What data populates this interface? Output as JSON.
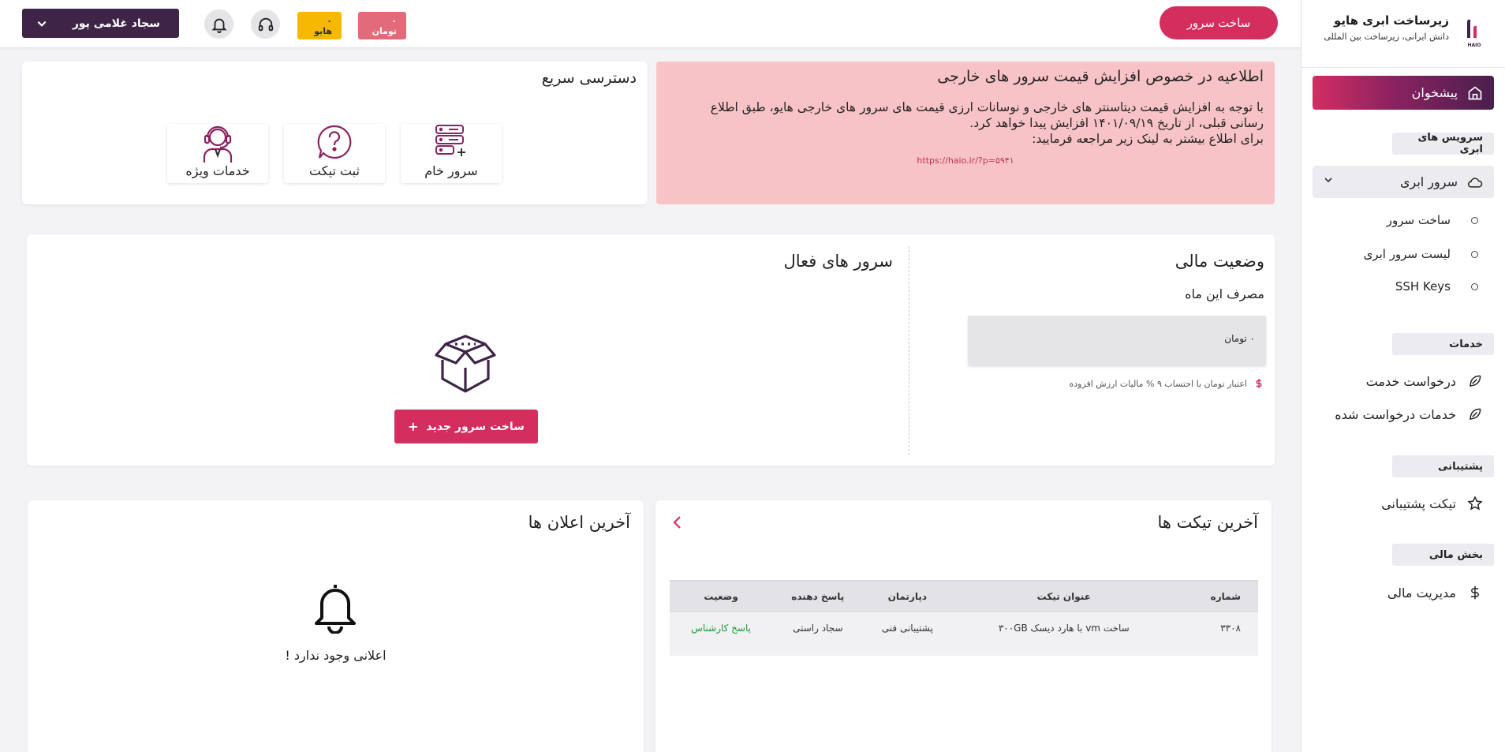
{
  "brand": {
    "title": "زیرساخت ابری هایو",
    "subtitle": "دانش ایرانی، زیرساخت بین المللی",
    "logo_text": "HAIO",
    "accent": "#d42e5f",
    "dark": "#3e2447"
  },
  "sidebar": {
    "dashboard_label": "پیشخوان",
    "sections": {
      "cloud_services": "سرویس های ابری",
      "services": "خدمات",
      "support": "پشتیبانی",
      "finance": "بخش مالی"
    },
    "cloud_server": "سرور ابری",
    "cloud_sub": [
      "ساخت سرور",
      "لیست سرور ابری",
      "SSH Keys"
    ],
    "services_items": [
      "درخواست خدمت",
      "خدمات درخواست شده"
    ],
    "support_items": [
      "تیکت پشتیبانی"
    ],
    "finance_items": [
      "مدیریت مالی"
    ]
  },
  "header": {
    "create_server": "ساخت سرور",
    "user_name": "سجاد غلامی پور",
    "haio_balance": "۰ هایو",
    "toman_balance": "۰ تومان"
  },
  "alert": {
    "title": "اطلاعیه در خصوص افزایش قیمت سرور های خارجی",
    "line1": "با توجه به افزایش قیمت دیتاسنتر های خارجی و نوسانات ارزی قیمت های سرور های خارجی هایو، طبق اطلاع",
    "line2": "رسانی قبلی، از تاریخ ۱۴۰۱/۰۹/۱۹ افزایش پیدا خواهد کرد.",
    "line3": "برای اطلاع بیشتر به لینک زیر مراجعه فرمایید:",
    "link": "https://haio.ir/?p=۵۹۴۱"
  },
  "quick_access": {
    "title": "دسترسی سریع",
    "tiles": [
      "سرور خام",
      "ثبت تیکت",
      "خدمات ویژه"
    ]
  },
  "finance": {
    "title": "وضعیت مالی",
    "month_usage": "مصرف این ماه",
    "amount": "۰ تومان",
    "note": "اعتبار تومان با احتساب ۹ % مالیات ارزش افزوده"
  },
  "active_servers": {
    "title": "سرور های فعال",
    "new_button": "ساخت سرور جدید",
    "plus": "+"
  },
  "tickets": {
    "title": "آخرین تیکت ها",
    "columns": [
      "شماره",
      "عنوان تیکت",
      "دپارتمان",
      "پاسخ دهنده",
      "وضعیت"
    ],
    "rows": [
      {
        "number": "۳۳۰۸",
        "subject": "ساخت vm با هارد دیسک ۳۰۰GB",
        "department": "پشتیبانی فنی",
        "responder": "سجاد راستی",
        "status": "پاسخ کارشناس"
      }
    ]
  },
  "notifications": {
    "title": "آخرین اعلان ها",
    "empty": "اعلانی وجود ندارد !"
  }
}
